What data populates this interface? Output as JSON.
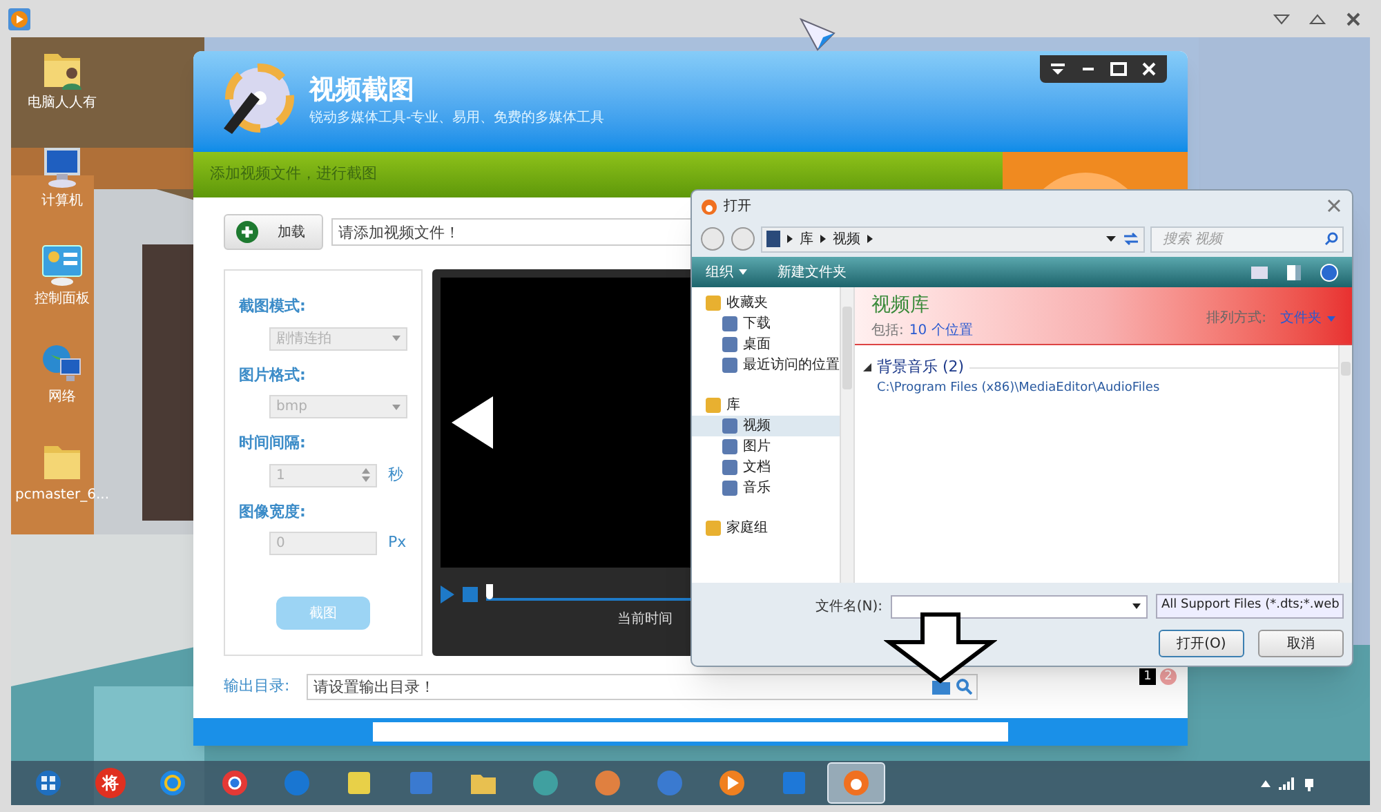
{
  "desktop_icons": [
    {
      "label": "电脑人人有"
    },
    {
      "label": "计算机"
    },
    {
      "label": "控制面板"
    },
    {
      "label": "网络"
    },
    {
      "label": "pcmaster_6..."
    }
  ],
  "app": {
    "title": "视频截图",
    "subtitle": "锐动多媒体工具-专业、易用、免费的多媒体工具",
    "banner": "添加视频文件，进行截图",
    "load_button": "加载",
    "file_field": {
      "placeholder": "请添加视频文件！"
    },
    "options": [
      {
        "kind": "select",
        "label": "截图模式:",
        "value": "剧情连拍",
        "disabled": true
      },
      {
        "kind": "select",
        "label": "图片格式:",
        "value": "bmp",
        "disabled": true
      },
      {
        "kind": "spinner",
        "label": "时间间隔:",
        "value": "1",
        "unit": "秒",
        "disabled": true
      },
      {
        "kind": "input",
        "label": "图像宽度:",
        "value": "0",
        "unit": "Px",
        "disabled": true
      }
    ],
    "capture_button": {
      "label": "截图",
      "disabled": true
    },
    "player": {
      "level": 0,
      "time_label": "当前时间"
    },
    "output": {
      "label": "输出目录:",
      "placeholder": "请设置输出目录！"
    },
    "ad_pages": [
      {
        "label": "1",
        "selected": true
      },
      {
        "label": "2",
        "selected": false
      }
    ]
  },
  "dialog": {
    "title": "打开",
    "breadcrumb": [
      "库",
      "视频"
    ],
    "search": {
      "placeholder": "搜索 视频"
    },
    "toolbar": [
      "组织",
      "新建文件夹"
    ],
    "nav": [
      {
        "label": "收藏夹",
        "selected": false,
        "children": [
          {
            "label": "下载",
            "selected": false
          },
          {
            "label": "桌面",
            "selected": false
          },
          {
            "label": "最近访问的位置",
            "selected": false
          }
        ]
      },
      {
        "label": "库",
        "selected": false,
        "children": [
          {
            "label": "视频",
            "selected": true
          },
          {
            "label": "图片",
            "selected": false
          },
          {
            "label": "文档",
            "selected": false
          },
          {
            "label": "音乐",
            "selected": false
          }
        ]
      },
      {
        "label": "家庭组",
        "selected": false
      }
    ],
    "library": {
      "title": "视频库",
      "includes_label": "包括:",
      "includes_link": "10 个位置",
      "arrange_label": "排列方式:",
      "arrange_value": "文件夹"
    },
    "groups": [
      {
        "name": "背景音乐 (2)",
        "path": "C:\\Program Files (x86)\\MediaEditor\\AudioFiles",
        "expanded": true
      }
    ],
    "filename": {
      "label": "文件名(N):"
    },
    "filter": "All Support Files (*.dts;*.web",
    "buttons": [
      "打开(O)",
      "取消"
    ]
  },
  "taskbar": {
    "apps": [
      {
        "selected": false
      },
      {
        "selected": false,
        "glyph": "将"
      },
      {
        "selected": false
      },
      {
        "selected": false
      },
      {
        "selected": false
      },
      {
        "selected": false
      },
      {
        "selected": false
      },
      {
        "selected": false
      },
      {
        "selected": false
      },
      {
        "selected": false
      },
      {
        "selected": false
      },
      {
        "selected": false
      },
      {
        "selected": false
      },
      {
        "selected": true
      }
    ]
  }
}
